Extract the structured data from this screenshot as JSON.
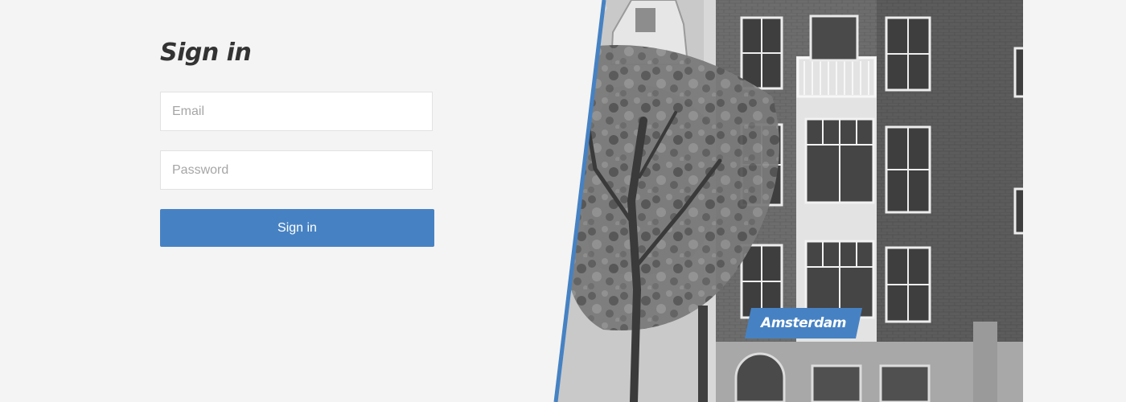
{
  "signin": {
    "title": "Sign in",
    "email": {
      "placeholder": "Email",
      "value": ""
    },
    "password": {
      "placeholder": "Password",
      "value": ""
    },
    "submit_label": "Sign in"
  },
  "photo": {
    "city_label": "Amsterdam",
    "style": "grayscale"
  },
  "colors": {
    "background": "#f4f4f4",
    "accent": "#4682c3",
    "title_text": "#333333",
    "input_border": "#e2e2e2",
    "placeholder_text": "#a6a6a6"
  },
  "icons": {
    "photo_panel": "amsterdam-canal-houses-photo"
  }
}
